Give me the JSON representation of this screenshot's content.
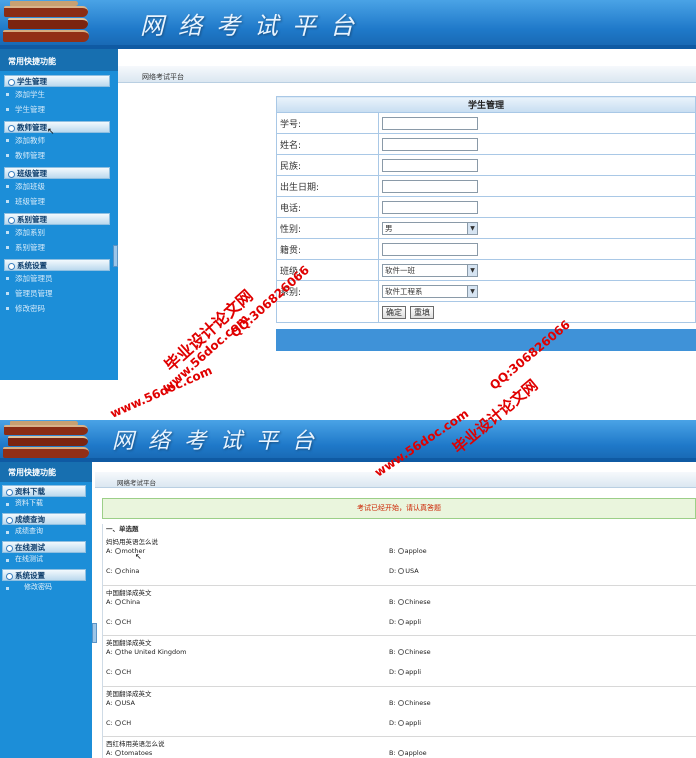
{
  "site_title": "网络考试平台",
  "breadcrumb": "网络考试平台",
  "sidebar_title": "常用快捷功能",
  "admin": {
    "groups": [
      {
        "title": "学生管理",
        "items": [
          "添加学生",
          "学生管理"
        ]
      },
      {
        "title": "教师管理",
        "items": [
          "添加教师",
          "教师管理"
        ]
      },
      {
        "title": "班级管理",
        "items": [
          "添加班级",
          "班级管理"
        ]
      },
      {
        "title": "系别管理",
        "items": [
          "添加系别",
          "系别管理"
        ]
      },
      {
        "title": "系统设置",
        "items": [
          "添加管理员",
          "管理员管理",
          "修改密码"
        ]
      }
    ],
    "form": {
      "title": "学生管理",
      "fields": {
        "student_id": "学号:",
        "name": "姓名:",
        "ethnicity": "民族:",
        "birthdate": "出生日期:",
        "phone": "电话:",
        "gender": "性别:",
        "hometown": "籍贯:",
        "class": "班级:",
        "department": "系别:"
      },
      "gender_value": "男",
      "class_value": "软件一班",
      "department_value": "软件工程系",
      "confirm": "确定",
      "reset": "重填"
    }
  },
  "student": {
    "groups": [
      {
        "title": "资料下载",
        "items": [
          "资料下载"
        ]
      },
      {
        "title": "成绩查询",
        "items": [
          "成绩查询"
        ]
      },
      {
        "title": "在线测试",
        "items": [
          "在线测试"
        ]
      },
      {
        "title": "系统设置",
        "items": [
          "修改密码"
        ]
      }
    ],
    "notice": "考试已经开始，请认真答题",
    "section": "一、单选题",
    "questions": [
      {
        "text": "妈妈用英语怎么说",
        "a": "mother",
        "b": "apploe",
        "c": "china",
        "d": "USA"
      },
      {
        "text": "中国翻译成英文",
        "a": "China",
        "b": "Chinese",
        "c": "CH",
        "d": "appli"
      },
      {
        "text": "英国翻译成英文",
        "a": "the United Kingdom",
        "b": "Chinese",
        "c": "CH",
        "d": "appli"
      },
      {
        "text": "美国翻译成英文",
        "a": "USA",
        "b": "Chinese",
        "c": "CH",
        "d": "appli"
      },
      {
        "text": "西红柿用英语怎么说",
        "a": "tomatoes",
        "b": "apploe",
        "c": "",
        "d": ""
      }
    ]
  },
  "watermarks": {
    "brand": "毕业设计论文网",
    "site": "www.56doc.com",
    "qq": "QQ:306826066"
  }
}
